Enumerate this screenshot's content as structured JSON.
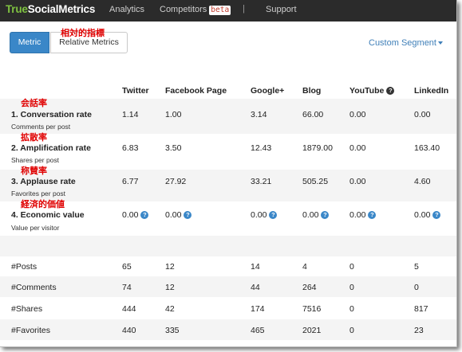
{
  "header": {
    "logo_part1": "True",
    "logo_part2": "SocialMetrics",
    "nav": [
      "Analytics",
      "Competitors",
      "Support"
    ],
    "beta_badge": "beta",
    "separator": "|"
  },
  "toolbar": {
    "metric_label": "Metric",
    "relative_label": "Relative Metrics",
    "relative_annotation": "相対的指標",
    "segment_label": "Custom Segment"
  },
  "columns": [
    "Twitter",
    "Facebook Page",
    "Google+",
    "Blog",
    "YouTube",
    "LinkedIn"
  ],
  "metrics": [
    {
      "annotation": "会話率",
      "name": "1. Conversation rate",
      "sub": "Comments per post",
      "values": [
        "1.14",
        "1.00",
        "3.14",
        "66.00",
        "0.00",
        "0.00"
      ]
    },
    {
      "annotation": "拡散率",
      "name": "2. Amplification rate",
      "sub": "Shares per post",
      "values": [
        "6.83",
        "3.50",
        "12.43",
        "1879.00",
        "0.00",
        "163.40"
      ]
    },
    {
      "annotation": "称賛率",
      "name": "3. Applause rate",
      "sub": "Favorites per post",
      "values": [
        "6.77",
        "27.92",
        "33.21",
        "505.25",
        "0.00",
        "4.60"
      ]
    },
    {
      "annotation": "経済的価値",
      "name": "4. Economic value",
      "sub": "Value per visitor",
      "values": [
        "0.00",
        "0.00",
        "0.00",
        "0.00",
        "0.00",
        "0.00"
      ]
    }
  ],
  "counts": [
    {
      "label": "#Posts",
      "values": [
        "65",
        "12",
        "14",
        "4",
        "0",
        "5"
      ]
    },
    {
      "label": "#Comments",
      "values": [
        "74",
        "12",
        "44",
        "264",
        "0",
        "0"
      ]
    },
    {
      "label": "#Shares",
      "values": [
        "444",
        "42",
        "174",
        "7516",
        "0",
        "817"
      ]
    },
    {
      "label": "#Favorites",
      "values": [
        "440",
        "335",
        "465",
        "2021",
        "0",
        "23"
      ]
    }
  ],
  "help_glyph": "?",
  "colors": {
    "brand_green": "#7fc241",
    "topbar": "#2b2b2b",
    "accent_blue": "#3a87c8",
    "annotation_red": "#e00000",
    "link_blue": "#3f7fb8"
  }
}
